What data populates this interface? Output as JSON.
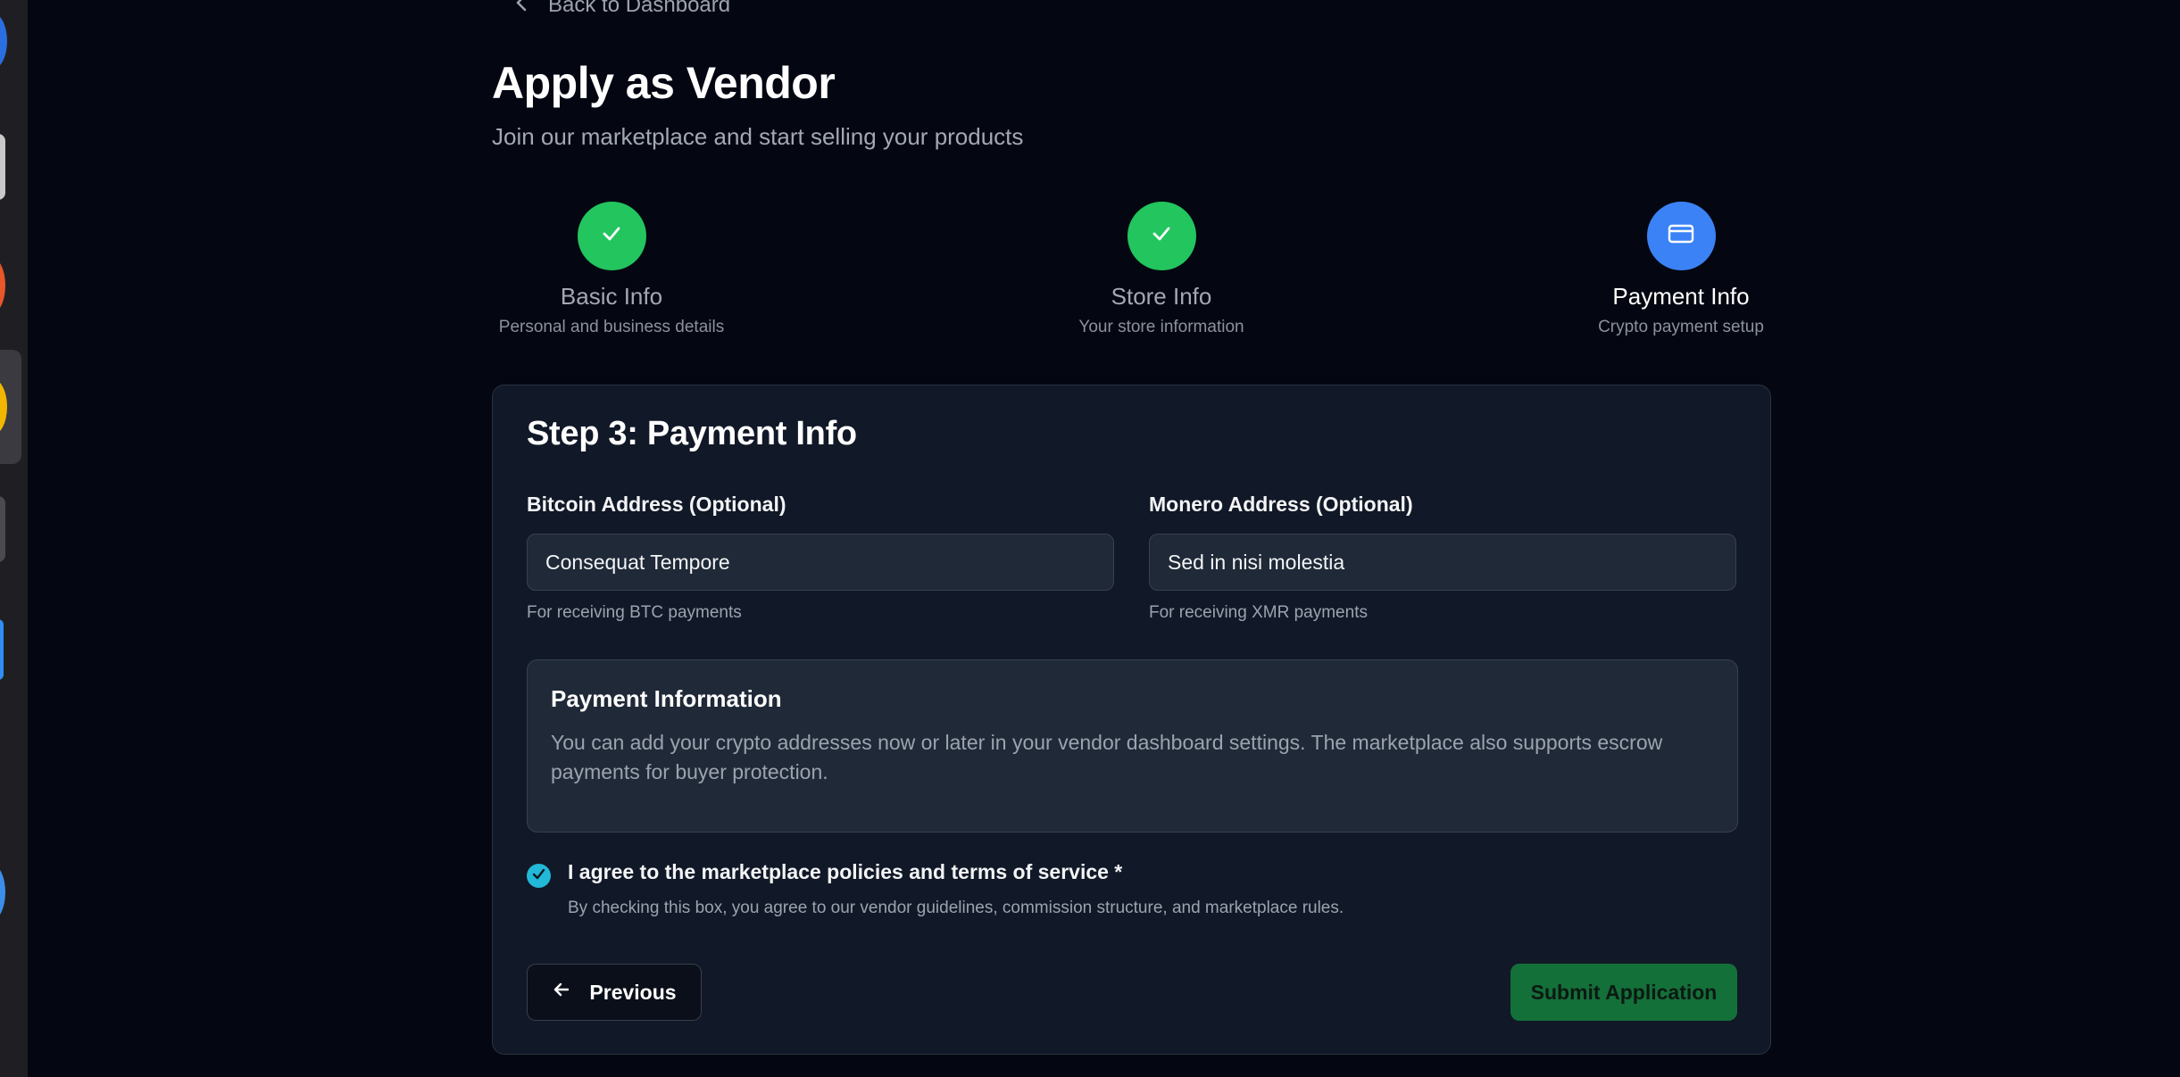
{
  "nav": {
    "back_label": "Back to Dashboard"
  },
  "header": {
    "title": "Apply as Vendor",
    "subtitle": "Join our marketplace and start selling your products"
  },
  "steps": [
    {
      "title": "Basic Info",
      "description": "Personal and business details",
      "status": "complete",
      "icon": "check-icon"
    },
    {
      "title": "Store Info",
      "description": "Your store information",
      "status": "complete",
      "icon": "check-icon"
    },
    {
      "title": "Payment Info",
      "description": "Crypto payment setup",
      "status": "active",
      "icon": "credit-card-icon"
    }
  ],
  "form": {
    "title": "Step 3: Payment Info",
    "bitcoin": {
      "label": "Bitcoin Address (Optional)",
      "value": "Consequat Tempore",
      "help": "For receiving BTC payments"
    },
    "monero": {
      "label": "Monero Address (Optional)",
      "value": "Sed in nisi molestia",
      "help": "For receiving XMR payments"
    },
    "info": {
      "title": "Payment Information",
      "text": "You can add your crypto addresses now or later in your vendor dashboard settings. The marketplace also supports escrow payments for buyer protection."
    },
    "agree": {
      "checked": true,
      "label": "I agree to the marketplace policies and terms of service *",
      "description": "By checking this box, you agree to our vendor guidelines, commission structure, and marketplace rules."
    },
    "previous_label": "Previous",
    "submit_label": "Submit Application"
  },
  "colors": {
    "background": "#040711",
    "card": "#111827",
    "step_complete": "#22c55e",
    "step_active": "#3b82f6",
    "checkbox": "#22b8d8",
    "submit": "#15803d"
  }
}
